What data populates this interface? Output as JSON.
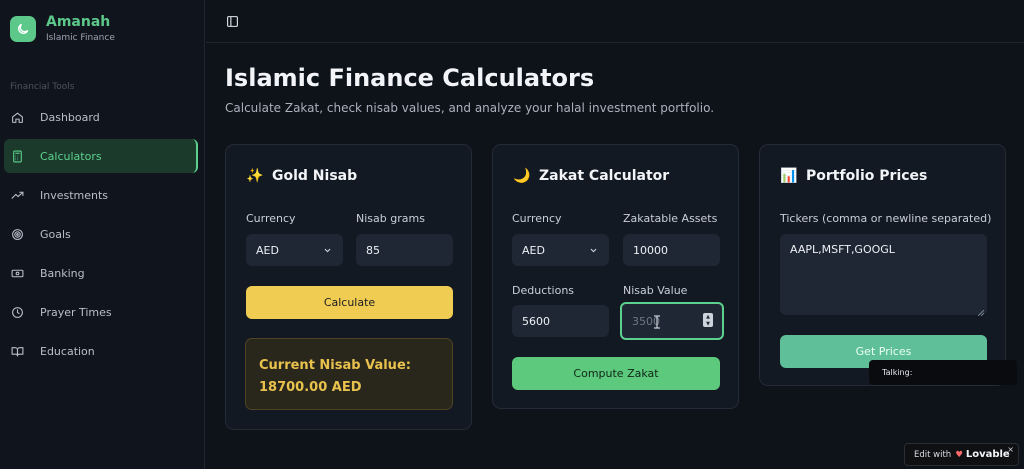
{
  "brand": {
    "name": "Amanah",
    "subtitle": "Islamic Finance"
  },
  "sidebar": {
    "section_label": "Financial Tools",
    "items": [
      {
        "label": "Dashboard",
        "icon": "home-icon"
      },
      {
        "label": "Calculators",
        "icon": "calculator-icon",
        "active": true
      },
      {
        "label": "Investments",
        "icon": "trend-up-icon"
      },
      {
        "label": "Goals",
        "icon": "target-icon"
      },
      {
        "label": "Banking",
        "icon": "banknote-icon"
      },
      {
        "label": "Prayer Times",
        "icon": "clock-icon"
      },
      {
        "label": "Education",
        "icon": "book-icon"
      }
    ]
  },
  "page": {
    "title": "Islamic Finance Calculators",
    "subtitle": "Calculate Zakat, check nisab values, and analyze your halal investment portfolio."
  },
  "gold_nisab": {
    "emoji": "✨",
    "title": "Gold Nisab",
    "currency_label": "Currency",
    "currency_value": "AED",
    "grams_label": "Nisab grams",
    "grams_value": "85",
    "button": "Calculate",
    "result_line1": "Current Nisab Value:",
    "result_line2": "18700.00 AED"
  },
  "zakat": {
    "emoji": "🌙",
    "title": "Zakat Calculator",
    "currency_label": "Currency",
    "currency_value": "AED",
    "assets_label": "Zakatable Assets",
    "assets_value": "10000",
    "deductions_label": "Deductions",
    "deductions_value": "5600",
    "nisab_label": "Nisab Value",
    "nisab_placeholder": "3500",
    "button": "Compute Zakat"
  },
  "portfolio": {
    "emoji": "📊",
    "title": "Portfolio Prices",
    "tickers_label": "Tickers (comma or newline separated)",
    "tickers_value": "AAPL,MSFT,GOOGL",
    "button": "Get Prices"
  },
  "tooltip": {
    "text": "Talking:"
  },
  "badge": {
    "prefix": "Edit with",
    "brand": "Lovable",
    "close": "×"
  },
  "colors": {
    "accent": "#5cc98a",
    "gold": "#f1cc52",
    "background": "#0e1219"
  }
}
